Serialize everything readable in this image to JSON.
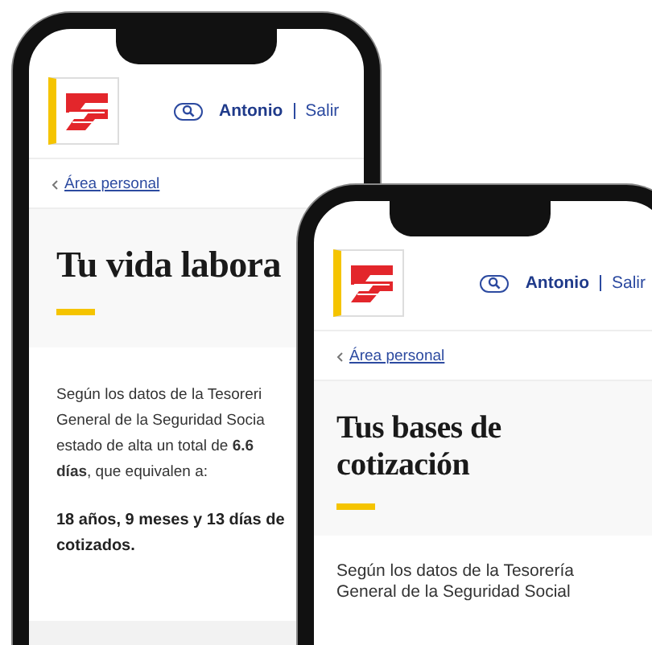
{
  "phones": [
    {
      "user": "Antonio",
      "logout": "Salir",
      "breadcrumb": "Área personal",
      "title": "Tu vida labora",
      "paragraphs": [
        {
          "kind": "body",
          "lines": [
            "Según los datos de la Tesoreri",
            "General de la Seguridad Socia",
            "estado de alta un total de **6.6**",
            "**días**, que equivalen a:"
          ]
        },
        {
          "kind": "emphasis",
          "lines": [
            "18 años, 9 meses y 13 días de",
            "cotizados."
          ]
        }
      ]
    },
    {
      "user": "Antonio",
      "logout": "Salir",
      "breadcrumb": "Área personal",
      "title": "Tus bases de cotización",
      "paragraphs": [
        {
          "kind": "body",
          "lines": [
            "Según los datos de la Tesorería",
            "General de la Seguridad Social"
          ]
        }
      ]
    }
  ]
}
